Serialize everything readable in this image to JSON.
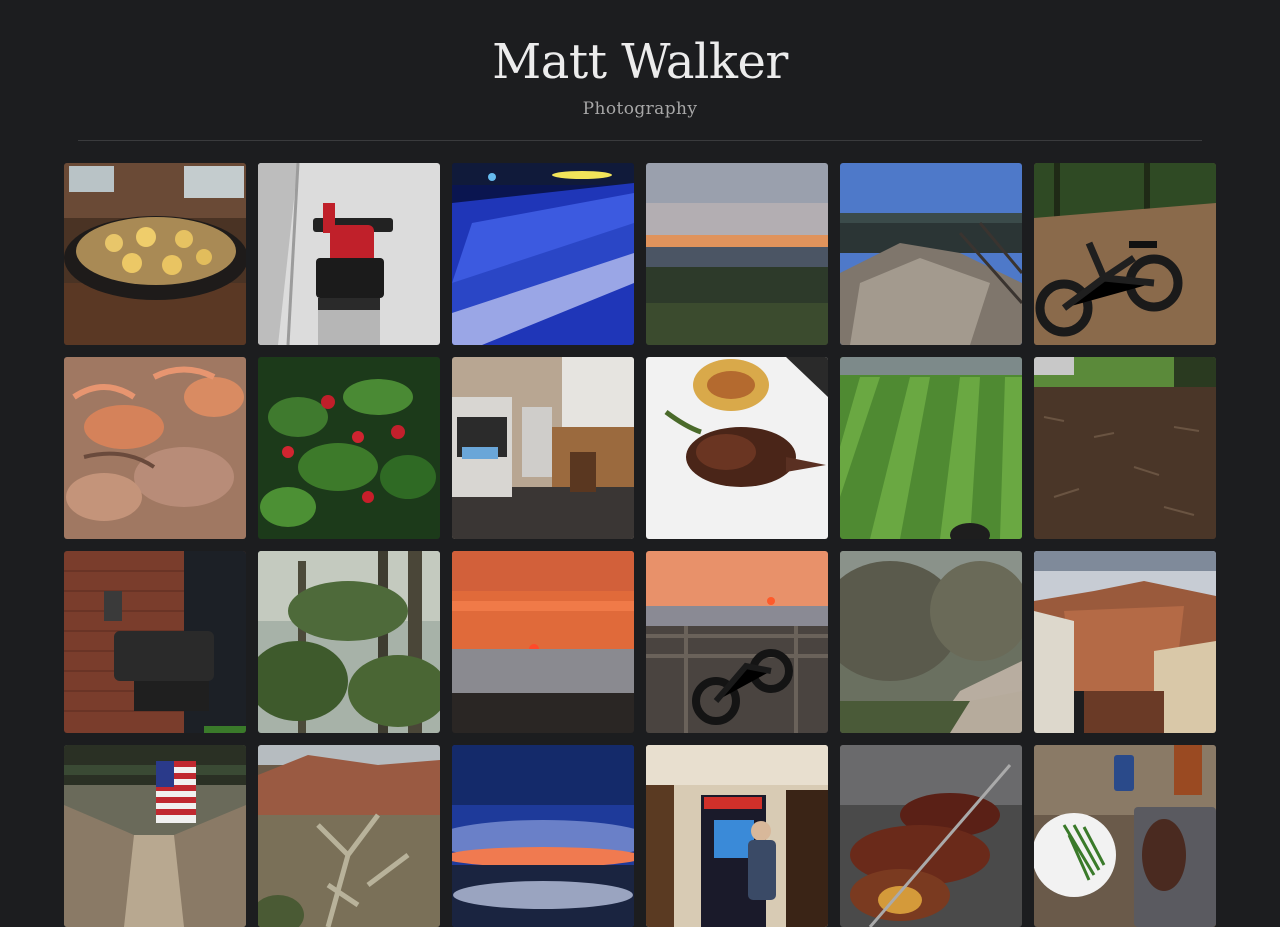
{
  "header": {
    "title": "Matt Walker",
    "subtitle": "Photography"
  },
  "colors": {
    "background": "#1c1d1f",
    "title": "#ececec",
    "subtitle": "#a7a7a7",
    "divider": "#3a3b3d"
  },
  "gallery": {
    "photos": [
      {
        "subject": "cast-iron-skillet-eggs"
      },
      {
        "subject": "snowblower-in-snow"
      },
      {
        "subject": "snow-tubing-lanes-night"
      },
      {
        "subject": "sunset-over-valley"
      },
      {
        "subject": "rock-overlook-river-valley"
      },
      {
        "subject": "electric-fat-tire-bike-trail"
      },
      {
        "subject": "steamed-crabs"
      },
      {
        "subject": "red-pepper-plant"
      },
      {
        "subject": "espresso-coffee-station"
      },
      {
        "subject": "carolina-reaper-peppers"
      },
      {
        "subject": "striped-mowed-lawn"
      },
      {
        "subject": "mulched-garden-bed"
      },
      {
        "subject": "pellet-smoker-brick-wall"
      },
      {
        "subject": "swamp-cypress-forest"
      },
      {
        "subject": "orange-sunset-over-water"
      },
      {
        "subject": "bike-on-deck-sunset"
      },
      {
        "subject": "live-oak-trail-spanish-moss"
      },
      {
        "subject": "dam-red-rock-canyon"
      },
      {
        "subject": "industrial-hall-american-flag"
      },
      {
        "subject": "desert-cholla-mountain"
      },
      {
        "subject": "airplane-window-sunrise"
      },
      {
        "subject": "boy-playing-arcade-cabinet"
      },
      {
        "subject": "grilled-meat-skewers"
      },
      {
        "subject": "steak-and-green-beans-dinner"
      }
    ]
  }
}
